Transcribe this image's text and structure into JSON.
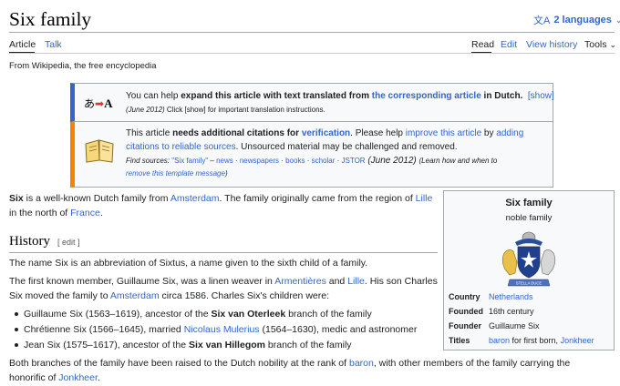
{
  "header": {
    "title": "Six family",
    "languages_label": "2 languages",
    "tagline": "From Wikipedia, the free encyclopedia"
  },
  "tabs": {
    "article": "Article",
    "talk": "Talk",
    "read": "Read",
    "edit": "Edit",
    "history": "View history",
    "tools": "Tools"
  },
  "box_translate": {
    "t1": "You can help ",
    "t2": "expand this article with text translated from ",
    "t3": "the corresponding article",
    "t4": " in Dutch.",
    "show": "[show]",
    "date": "(June 2012)",
    "note": " Click [show] for important translation instructions."
  },
  "box_cite": {
    "t1": "This article ",
    "t2": "needs additional citations for ",
    "t3": "verification",
    "t4": ". Please help ",
    "t5": "improve this article",
    "t6": " by ",
    "t7": "adding",
    "t8": "citations to reliable sources",
    "t9": ". Unsourced material may be challenged and removed.",
    "find": "Find sources: ",
    "src1": "\"Six family\"",
    "sep1": " – ",
    "src2": "news",
    "src3": "newspapers",
    "src4": "books",
    "src5": "scholar",
    "src6": "JSTOR",
    "date": " (June 2012) ",
    "learn1": "(Learn how and when to",
    "learn2": "remove this template message",
    "learn3": ")",
    "dot": " · "
  },
  "intro": {
    "b": "Six",
    "t1": " is a well-known Dutch family from ",
    "l1": "Amsterdam",
    "t2": ". The family originally came from the region of ",
    "l2": "Lille",
    "t3": "in the north of ",
    "l3": "France",
    "t4": "."
  },
  "history": {
    "heading": "History",
    "edit": "[ edit ]",
    "p1": "The name Six is an abbreviation of Sixtus, a name given to the sixth child of a family.",
    "p2a": "The first known member, Guillaume Six, was a linen weaver in ",
    "p2l1": "Armentières",
    "p2b": " and ",
    "p2l2": "Lille",
    "p2c": ". His son Charles",
    "p2d": "Six moved the family to ",
    "p2l3": "Amsterdam",
    "p2e": " circa 1586. Charles Six's children were:",
    "li1a": "Guillaume Six (1563–1619), ancestor of the ",
    "li1b": "Six van Oterleek",
    "li1c": " branch of the family",
    "li2a": "Chrétienne Six (1566–1645), married ",
    "li2l": "Nicolaus Mulerius",
    "li2b": " (1564–1630), medic and astronomer",
    "li3a": "Jean Six (1575–1617), ancestor of the ",
    "li3b": "Six van Hillegom",
    "li3c": " branch of the family",
    "p3a": "Both branches of the family have been raised to the Dutch nobility at the rank of ",
    "p3l1": "baron",
    "p3b": ", with other members of the family carrying the",
    "p3c": "honorific of ",
    "p3l2": "Jonkheer",
    "p3d": "."
  },
  "infobox": {
    "title": "Six family",
    "subtitle": "noble family",
    "rows": [
      {
        "label": "Country",
        "value": "Netherlands"
      },
      {
        "label": "Founded",
        "value": "16th century"
      },
      {
        "label": "Founder",
        "value": "Guillaume Six"
      },
      {
        "label": "Titles",
        "value_link1": "baron",
        "value_text": " for first born, ",
        "value_link2": "Jonkheer"
      }
    ],
    "motto": "STELLA DUCE"
  },
  "icons": {
    "translate": "translate-icon",
    "book": "book-icon",
    "coat_of_arms": "coat-of-arms-icon"
  },
  "colors": {
    "link": "#3366cc",
    "translate_bar": "#3366cc",
    "cite_bar": "#f28500"
  }
}
